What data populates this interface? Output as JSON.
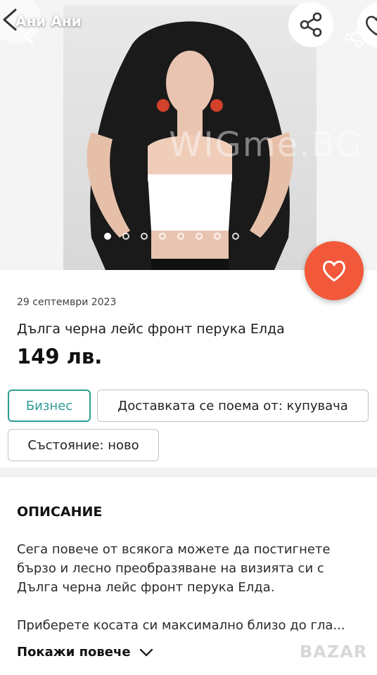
{
  "header": {
    "seller_name": "Ани Ани",
    "watermark": "WIGme.BG"
  },
  "gallery": {
    "total_images": 8,
    "active_index": 0
  },
  "listing": {
    "date": "29 септември 2023",
    "title": "Дълга черна лейс фронт перука Елда",
    "price": "149 лв."
  },
  "tags": {
    "business": "Бизнес",
    "delivery": "Доставката се поема от: купувача",
    "condition": "Състояние: ново"
  },
  "description": {
    "heading": "ОПИСАНИЕ",
    "paragraph1": "Сега повече от всякога можете да постигнете бързо и лесно преобразяване на визията си с Дълга черна лейс фронт перука Елда.",
    "paragraph2": "Приберете косата си максимално близо до гла...",
    "show_more": "Покажи повече"
  },
  "brand": {
    "logo_text": "BAZAR"
  },
  "colors": {
    "accent_teal": "#2f9c93",
    "favorite_orange": "#f2593a",
    "text": "#1c1c1c"
  },
  "icons": {
    "back": "chevron-left-icon",
    "share": "share-icon",
    "favorite": "heart-icon",
    "expand": "chevron-down-icon"
  }
}
